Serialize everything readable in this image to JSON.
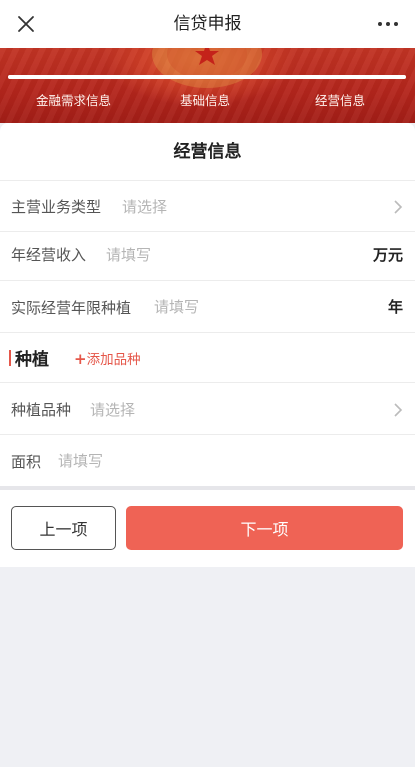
{
  "nav": {
    "title": "信贷申报",
    "close_icon": "close-icon",
    "more_icon": "more-dots-icon"
  },
  "progress": {
    "steps": [
      "金融需求信息",
      "基础信息",
      "经营信息"
    ],
    "fraction": 1.0,
    "banner_color": "#b3251c"
  },
  "form": {
    "title": "经营信息",
    "main_business": {
      "label": "主营业务类型",
      "placeholder": "请选择"
    },
    "annual_income": {
      "label": "年经营收入",
      "placeholder": "请填写",
      "unit": "万元"
    },
    "years_planting": {
      "label": "实际经营年限种植",
      "placeholder": "请填写",
      "unit": "年"
    },
    "section": {
      "title": "种植",
      "add_plus": "+",
      "add_label": "添加品种"
    },
    "variety": {
      "label": "种植品种",
      "placeholder": "请选择"
    },
    "area": {
      "label": "面积",
      "placeholder": "请填写"
    }
  },
  "buttons": {
    "prev": "上一项",
    "next": "下一项"
  },
  "colors": {
    "accent": "#ef6355",
    "section_accent": "#e5574a"
  }
}
